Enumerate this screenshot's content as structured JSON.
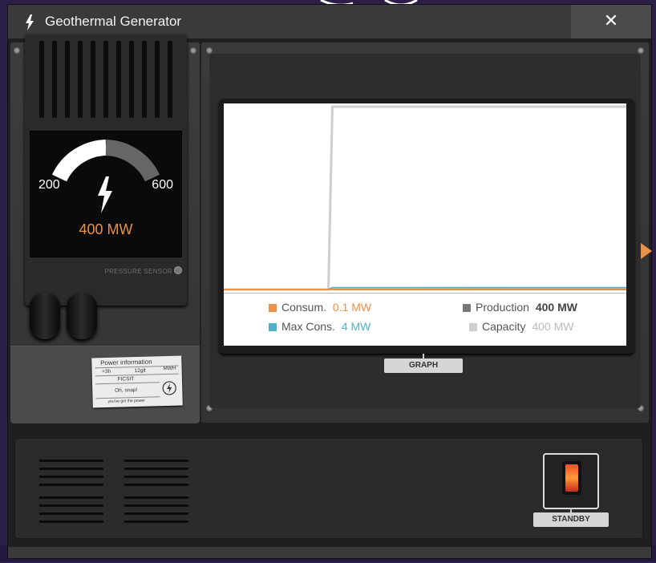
{
  "window": {
    "title": "Geothermal Generator",
    "close_label": "✕"
  },
  "gauge": {
    "min_label": "200",
    "max_label": "600",
    "value_text": "400 MW",
    "sensor_label": "PRESSURE SENSOR"
  },
  "sticker": {
    "title": "Power information",
    "cells": [
      "+3h",
      "12glt",
      "MWH"
    ],
    "brand": "FICSIT",
    "line2": "Oh, snap!",
    "footer": "you've got the power"
  },
  "graph": {
    "tab_label": "GRAPH",
    "legend": [
      {
        "label": "Consum.",
        "value": "0.1 MW",
        "color": "#e8924a",
        "value_color": "#e8924a"
      },
      {
        "label": "Production",
        "value": "400 MW",
        "color": "#777777",
        "value_color": "#444444"
      },
      {
        "label": "Max Cons.",
        "value": "4 MW",
        "color": "#4fb3c8",
        "value_color": "#4fb3c8"
      },
      {
        "label": "Capacity",
        "value": "400 MW",
        "color": "#cfcfcf",
        "value_color": "#bbbbbb"
      }
    ]
  },
  "bottom": {
    "standby_label": "STANDBY"
  },
  "colors": {
    "accent_orange": "#e8924a",
    "accent_cyan": "#4fb3c8",
    "switch_red": "#ff4a2a"
  },
  "chart_data": {
    "type": "line",
    "series": [
      {
        "name": "Capacity",
        "color": "#cfcfcf",
        "points": [
          [
            0,
            0
          ],
          [
            0.26,
            0
          ],
          [
            0.27,
            400
          ],
          [
            1,
            400
          ]
        ]
      },
      {
        "name": "Production",
        "color": "#777777",
        "points": [
          [
            0,
            0
          ],
          [
            0.26,
            0
          ],
          [
            1,
            0
          ]
        ]
      },
      {
        "name": "Max Cons.",
        "color": "#4fb3c8",
        "points": [
          [
            0,
            0
          ],
          [
            0.26,
            0
          ],
          [
            0.27,
            4
          ],
          [
            1,
            4
          ]
        ]
      },
      {
        "name": "Consum.",
        "color": "#e8924a",
        "points": [
          [
            0,
            0
          ],
          [
            1,
            0.1
          ]
        ]
      }
    ],
    "ylim": [
      0,
      400
    ],
    "grid": false
  }
}
